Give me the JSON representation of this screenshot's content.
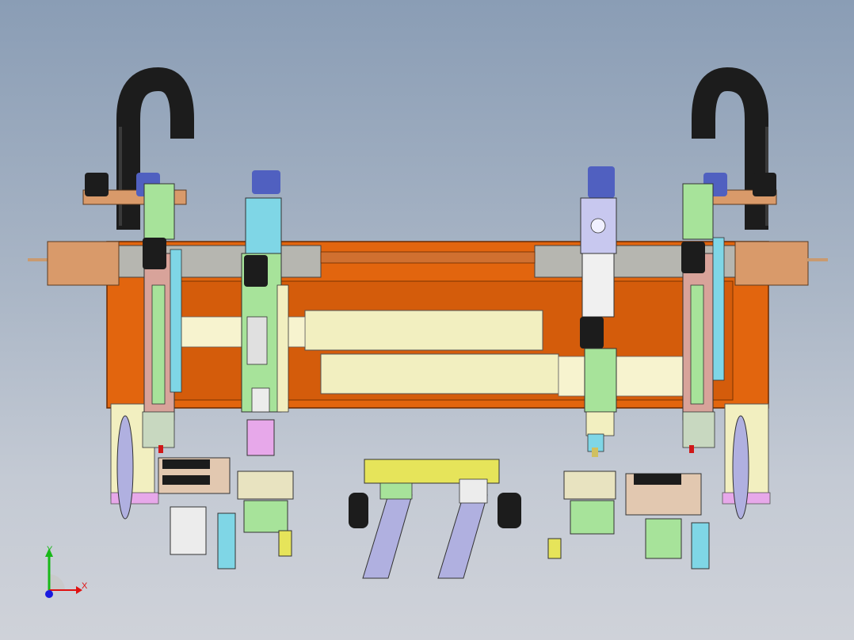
{
  "viewport": {
    "background_top": "#8a9db5",
    "background_bottom": "#cfd2d9"
  },
  "colors": {
    "frame_orange": "#e2650e",
    "frame_orange_dark": "#b84f08",
    "hose_black": "#1c1c1c",
    "cream_rail": "#f2efc0",
    "green_part": "#a7e39a",
    "pink_part": "#d8a39a",
    "lavender_part": "#c8c8ef",
    "tan_block": "#d99a6a",
    "cyan_part": "#7fd6e6",
    "yellow_rail": "#e6e45a",
    "purple_slide": "#b0b0e0",
    "magenta_part": "#e7a8ea"
  },
  "triad": {
    "x_label": "X",
    "y_label": "Y",
    "x_color": "#e01010",
    "y_color": "#18b818",
    "z_color": "#1a1ae0"
  }
}
